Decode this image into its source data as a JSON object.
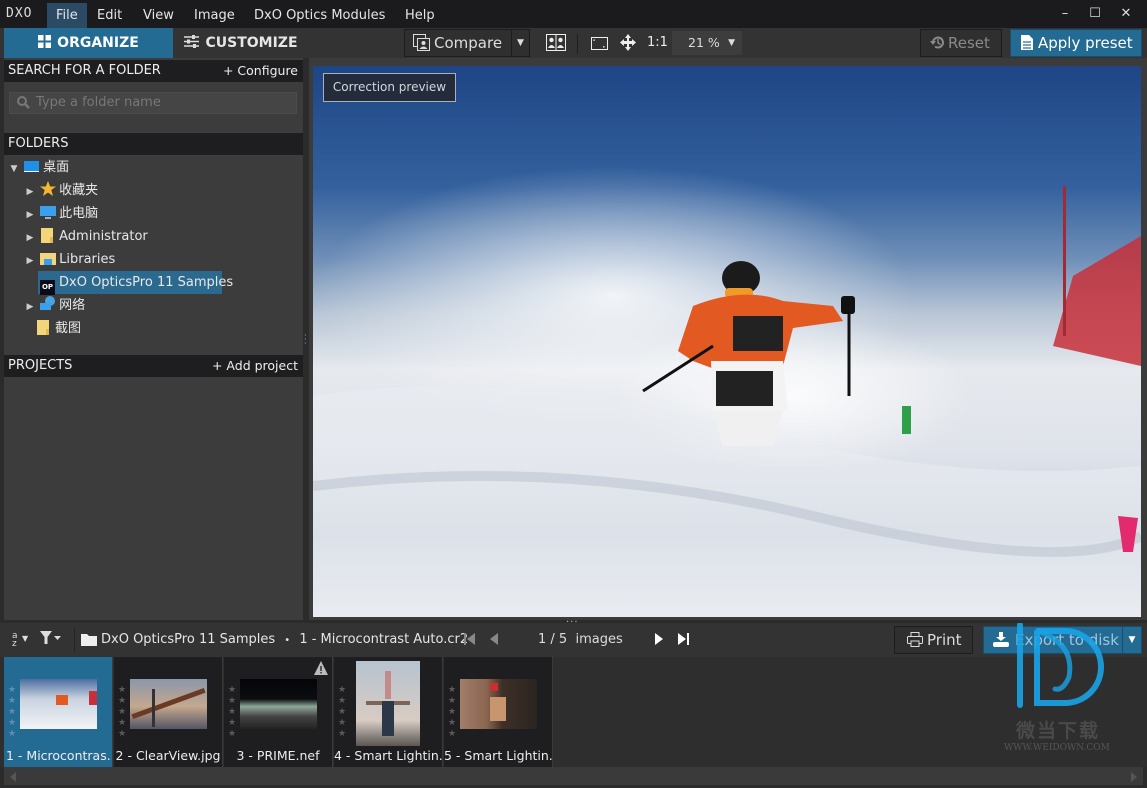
{
  "app": {
    "logo": "DXO"
  },
  "menu": {
    "items": [
      "File",
      "Edit",
      "View",
      "Image",
      "DxO Optics Modules",
      "Help"
    ],
    "active": "File"
  },
  "window_controls": {
    "minimize": "–",
    "maximize": "☐",
    "close": "✕"
  },
  "toolbar": {
    "tabs": [
      {
        "label": "ORGANIZE",
        "active": true
      },
      {
        "label": "CUSTOMIZE",
        "active": false
      }
    ],
    "compare_label": "Compare",
    "one_to_one": "1:1",
    "zoom_value": "21 %",
    "reset_label": "Reset",
    "apply_preset_label": "Apply preset"
  },
  "sidebar": {
    "search_header": "SEARCH FOR A FOLDER",
    "configure_label": "+ Configure",
    "search_placeholder": "Type a folder name",
    "folders_header": "FOLDERS",
    "tree": [
      {
        "label": "桌面",
        "icon": "desktop-icon",
        "expander": "expanded",
        "depth": 0
      },
      {
        "label": "收藏夹",
        "icon": "star-icon",
        "expander": "collapsed",
        "depth": 1
      },
      {
        "label": "此电脑",
        "icon": "computer-icon",
        "expander": "collapsed",
        "depth": 1
      },
      {
        "label": "Administrator",
        "icon": "folder-icon",
        "expander": "collapsed",
        "depth": 1
      },
      {
        "label": "Libraries",
        "icon": "libraries-icon",
        "expander": "collapsed",
        "depth": 1
      },
      {
        "label": "DxO OpticsPro 11 Samples",
        "icon": "dxo-op-icon",
        "expander": "none",
        "depth": 1,
        "selected": true
      },
      {
        "label": "网络",
        "icon": "network-icon",
        "expander": "collapsed",
        "depth": 1
      },
      {
        "label": "截图",
        "icon": "folder-icon",
        "expander": "none",
        "depth": 1
      }
    ],
    "projects_header": "PROJECTS",
    "add_project_label": "+ Add project"
  },
  "viewer": {
    "overlay_label": "Correction preview"
  },
  "bottombar": {
    "folder": "DxO OpticsPro 11 Samples",
    "separator": "•",
    "file": "1 - Microcontrast Auto.cr2",
    "counter": "1 / 5  images",
    "print_label": "Print",
    "export_label": "Export to disk"
  },
  "filmstrip": [
    {
      "caption": "1 - Microcontras...",
      "selected": true,
      "warning": false
    },
    {
      "caption": "2 - ClearView.jpg",
      "selected": false,
      "warning": false
    },
    {
      "caption": "3 - PRIME.nef",
      "selected": false,
      "warning": true
    },
    {
      "caption": "4 - Smart Lightin...",
      "selected": false,
      "warning": true
    },
    {
      "caption": "5 - Smart Lightin...",
      "selected": false,
      "warning": false
    }
  ],
  "watermark": {
    "cn": "微当下载",
    "url": "WWW.WEIDOWN.COM"
  },
  "colors": {
    "accent": "#246b94",
    "titlebar": "#1b1b1d",
    "panel": "#3c3c3c"
  }
}
